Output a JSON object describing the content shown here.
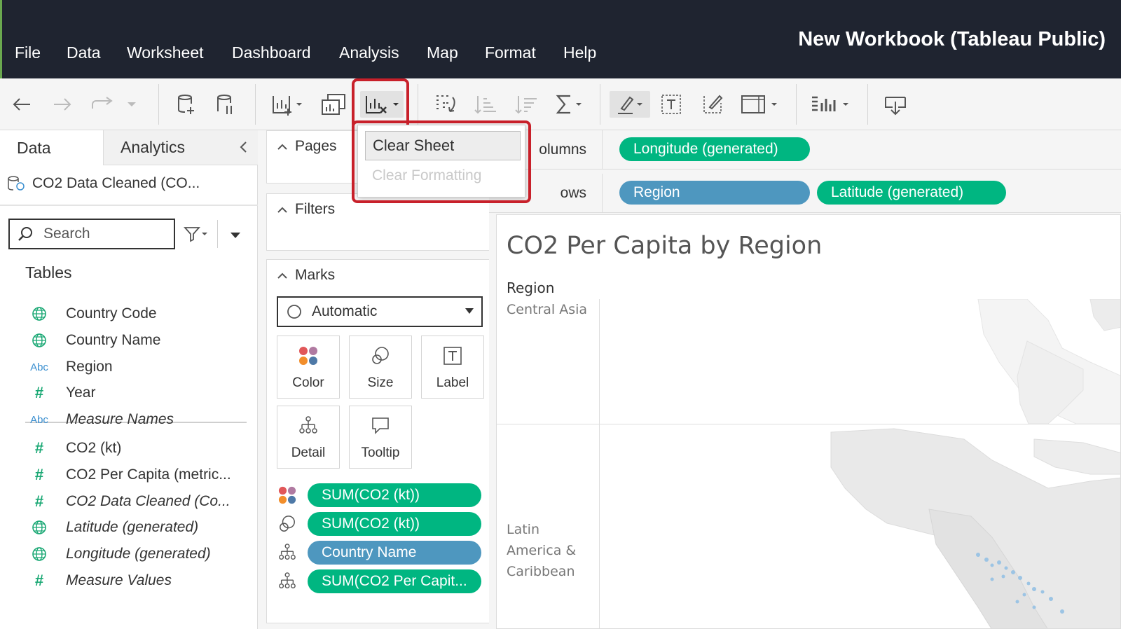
{
  "app": {
    "title": "New Workbook (Tableau Public)",
    "menu": [
      "File",
      "Data",
      "Worksheet",
      "Dashboard",
      "Analysis",
      "Map",
      "Format",
      "Help"
    ]
  },
  "toolbar": {
    "icons": [
      "back-icon",
      "forward-icon",
      "redo-icon",
      "history-dropdown-icon",
      "new-datasource-icon",
      "pause-updates-icon",
      "new-worksheet-icon",
      "duplicate-icon",
      "clear-sheet-icon",
      "swap-icon",
      "sort-ascending-icon",
      "sort-descending-icon",
      "totals-icon",
      "highlight-icon",
      "labels-icon",
      "format-icon",
      "fit-icon",
      "show-me-icon",
      "download-icon"
    ]
  },
  "data_pane": {
    "tabs": [
      "Data",
      "Analytics"
    ],
    "datasource": "CO2 Data Cleaned (CO...",
    "search_placeholder": "Search",
    "tables_label": "Tables",
    "fields": [
      {
        "icon": "globe",
        "name": "Country Code",
        "italic": false
      },
      {
        "icon": "globe",
        "name": "Country Name",
        "italic": false
      },
      {
        "icon": "abc",
        "name": "Region",
        "italic": false
      },
      {
        "icon": "hash",
        "name": "Year",
        "italic": false
      },
      {
        "icon": "abc",
        "name": "Measure Names",
        "italic": true
      },
      {
        "icon": "hash",
        "name": "CO2 (kt)",
        "italic": false
      },
      {
        "icon": "hash",
        "name": "CO2 Per Capita (metric...",
        "italic": false
      },
      {
        "icon": "hash",
        "name": "CO2 Data Cleaned (Co...",
        "italic": true
      },
      {
        "icon": "globe",
        "name": "Latitude (generated)",
        "italic": true
      },
      {
        "icon": "globe",
        "name": "Longitude (generated)",
        "italic": true
      },
      {
        "icon": "hash",
        "name": "Measure Values",
        "italic": true
      }
    ],
    "abc_text": "Abc",
    "hash_text": "#"
  },
  "shelves": {
    "pages": "Pages",
    "filters": "Filters",
    "marks": "Marks",
    "mark_type": "Automatic",
    "mark_buttons": [
      "Color",
      "Size",
      "Label",
      "Detail",
      "Tooltip"
    ],
    "mark_pills": [
      {
        "icon": "color",
        "label": "SUM(CO2 (kt))",
        "color": "#00b681"
      },
      {
        "icon": "size",
        "label": "SUM(CO2 (kt))",
        "color": "#00b681"
      },
      {
        "icon": "detail",
        "label": "Country Name",
        "color": "#4e97bf"
      },
      {
        "icon": "detail",
        "label": "SUM(CO2 Per Capit...",
        "color": "#00b681"
      }
    ],
    "columns_label": "olumns",
    "rows_label": "ows",
    "columns_pills": [
      "Longitude (generated)"
    ],
    "rows_pills": [
      "Region",
      "Latitude (generated)"
    ]
  },
  "viz": {
    "title": "CO2 Per Capita by Region",
    "row_header": "Region",
    "rows": [
      "Central Asia",
      "Latin\nAmerica &\nCaribbean"
    ]
  },
  "dropdown_menu": {
    "items": [
      "Clear Sheet",
      "Clear Formatting"
    ],
    "disabled": [
      false,
      true
    ]
  },
  "colors": {
    "menubar": "#1f2430",
    "measure_pill": "#00b681",
    "dimension_pill": "#4e97bf",
    "highlight": "#c8202a"
  }
}
